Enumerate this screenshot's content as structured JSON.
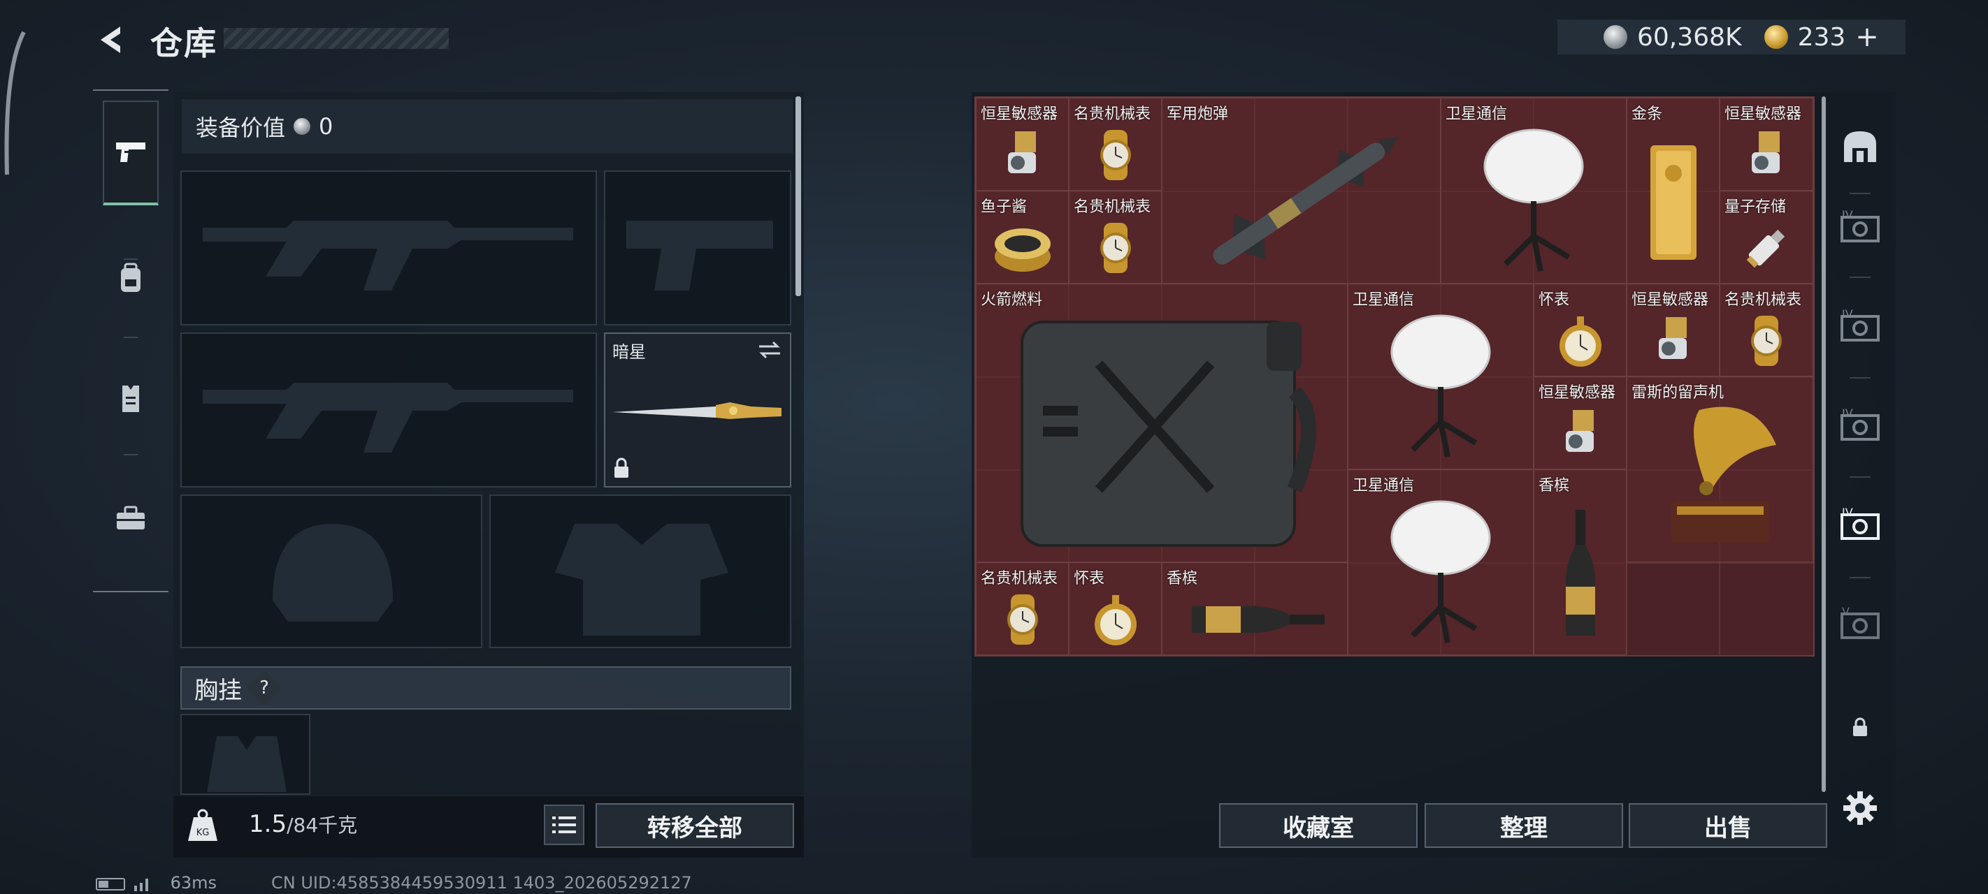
{
  "header": {
    "title": "仓库",
    "back_icon": "chevron-left-icon"
  },
  "currency": {
    "silver": "60,368K",
    "gold": "233",
    "gold_add": "+"
  },
  "left_rail": [
    {
      "name": "weapons",
      "icon": "pistol-icon",
      "selected": true
    },
    {
      "name": "backpack",
      "icon": "backpack-icon"
    },
    {
      "name": "vest",
      "icon": "vest-icon"
    },
    {
      "name": "toolbox",
      "icon": "toolbox-icon"
    }
  ],
  "equipment": {
    "value_label": "装备价值",
    "value": "0",
    "melee_name": "暗星",
    "chest_label": "胸挂",
    "chest_help": "?",
    "weight_current": "1.5",
    "weight_max": "/84千克",
    "transfer_all": "转移全部"
  },
  "stash": {
    "items": [
      {
        "label": "恒星敏感器",
        "icon": "sensor-icon"
      },
      {
        "label": "名贵机械表",
        "icon": "watch-icon"
      },
      {
        "label": "军用炮弹",
        "icon": "missile-icon"
      },
      {
        "label": "卫星通信",
        "icon": "satellite-dish-icon"
      },
      {
        "label": "金条",
        "icon": "gold-bar-icon"
      },
      {
        "label": "恒星敏感器",
        "icon": "sensor-icon"
      },
      {
        "label": "鱼子酱",
        "icon": "caviar-icon"
      },
      {
        "label": "名贵机械表",
        "icon": "watch-icon"
      },
      {
        "label": "量子存储",
        "icon": "usb-drive-icon"
      },
      {
        "label": "火箭燃料",
        "icon": "jerrycan-icon"
      },
      {
        "label": "卫星通信",
        "icon": "satellite-dish-icon"
      },
      {
        "label": "怀表",
        "icon": "pocket-watch-icon"
      },
      {
        "label": "恒星敏感器",
        "icon": "sensor-icon"
      },
      {
        "label": "名贵机械表",
        "icon": "watch-icon"
      },
      {
        "label": "恒星敏感器",
        "icon": "sensor-icon"
      },
      {
        "label": "雷斯的留声机",
        "icon": "gramophone-icon"
      },
      {
        "label": "卫星通信",
        "icon": "satellite-dish-icon"
      },
      {
        "label": "香槟",
        "icon": "champagne-icon"
      },
      {
        "label": "名贵机械表",
        "icon": "watch-icon"
      },
      {
        "label": "怀表",
        "icon": "pocket-watch-icon"
      },
      {
        "label": "香槟",
        "icon": "champagne-icon"
      }
    ],
    "buttons": {
      "collection": "收藏室",
      "sort": "整理",
      "sell": "出售"
    }
  },
  "sidebar_tabs": [
    "armory-icon",
    "tier-iv-crate-icon",
    "tier-iv-crate-icon",
    "tier-iv-crate-icon",
    "tier-iv-crate-icon",
    "tier-v-crate-icon",
    "lock-icon",
    "gear-icon"
  ],
  "status": {
    "ping": "63ms",
    "uid": "CN UID:4585384459530911 1403_202605292127"
  }
}
